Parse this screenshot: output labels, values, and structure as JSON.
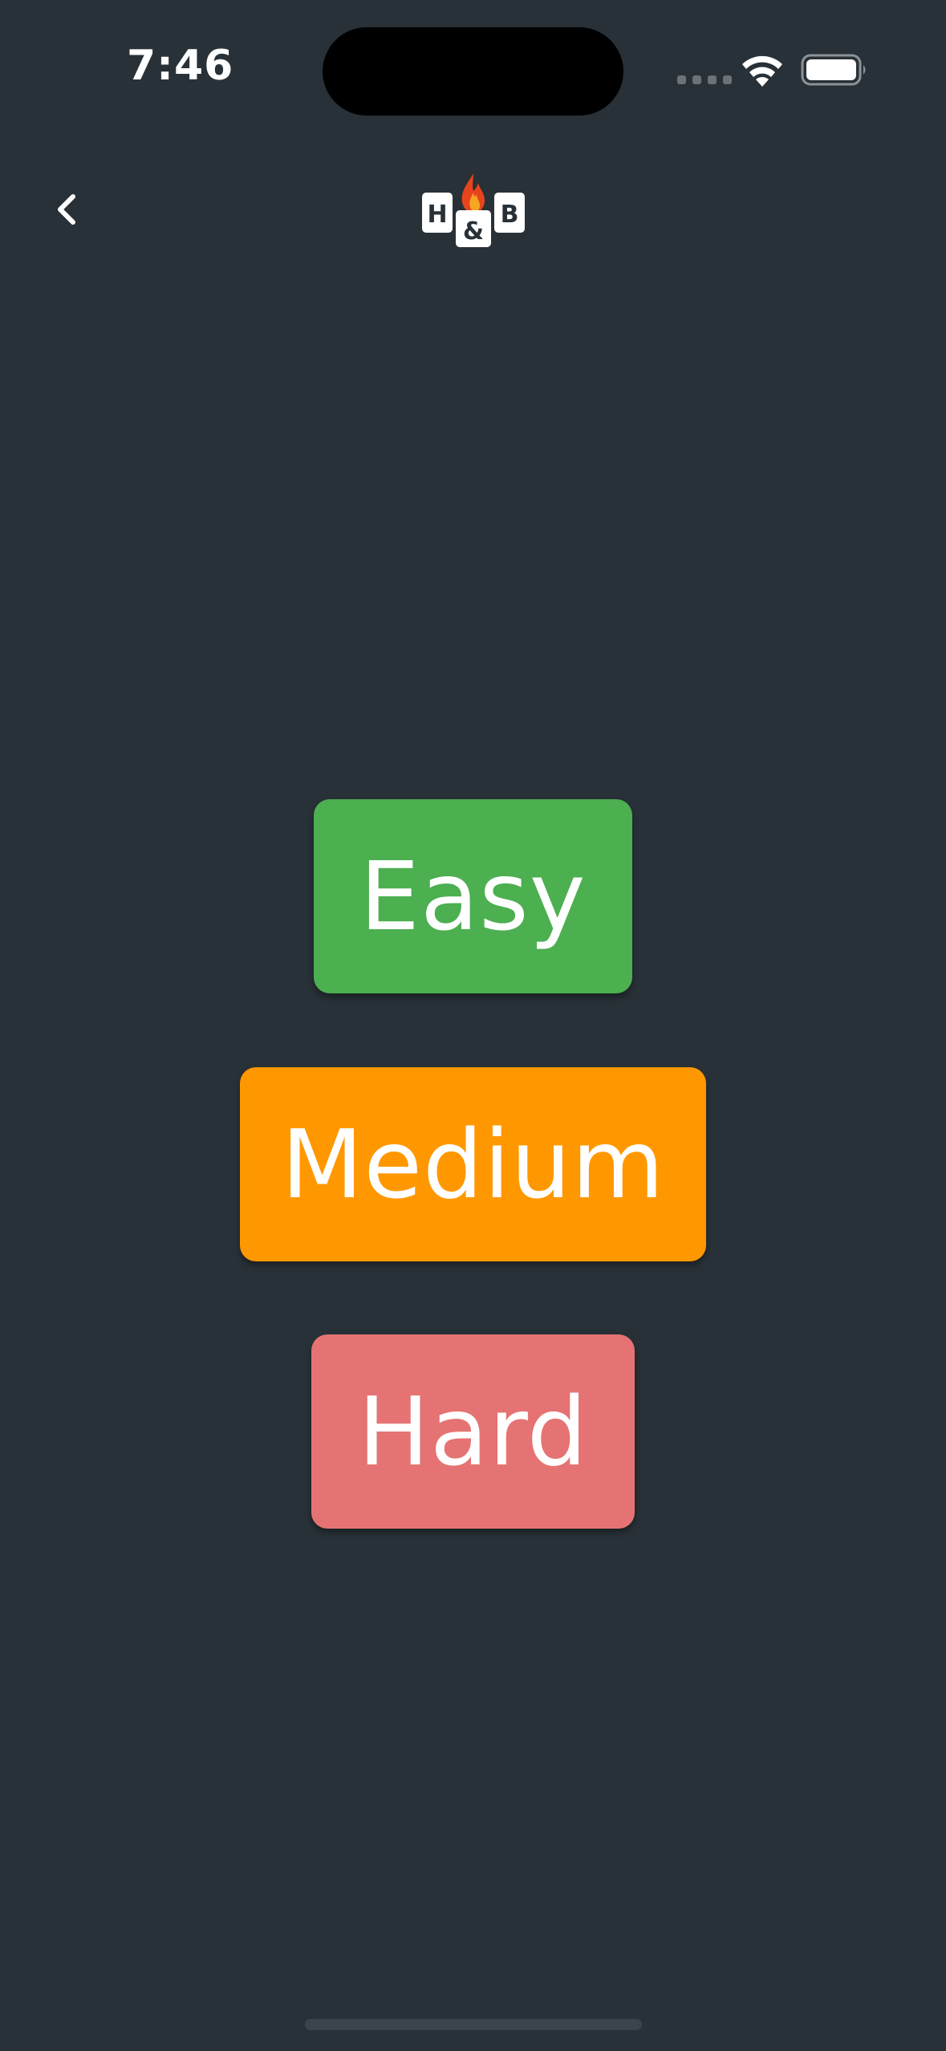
{
  "status_bar": {
    "time": "7:46",
    "icons": [
      "cellular-dots-icon",
      "wifi-icon",
      "battery-icon"
    ]
  },
  "nav": {
    "back_icon": "chevron-left-icon",
    "logo": {
      "left": "H",
      "middle": "&",
      "right": "B",
      "icon": "flame-icon"
    }
  },
  "difficulty": {
    "easy": {
      "label": "Easy",
      "color": "#4caf50"
    },
    "medium": {
      "label": "Medium",
      "color": "#ff9800"
    },
    "hard": {
      "label": "Hard",
      "color": "#e57373"
    }
  },
  "colors": {
    "background": "#283137",
    "text": "#ffffff"
  }
}
